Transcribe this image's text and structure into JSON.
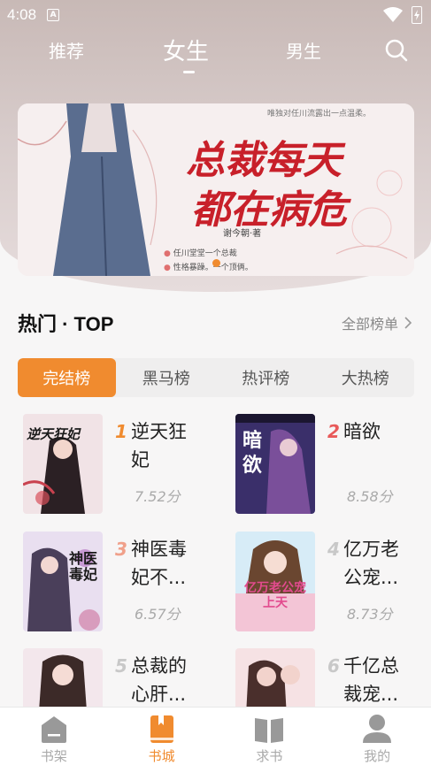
{
  "status_bar": {
    "time": "4:08",
    "notification_glyph": "A"
  },
  "top_nav": {
    "tabs": [
      {
        "label": "推荐",
        "active": false
      },
      {
        "label": "女生",
        "active": true
      },
      {
        "label": "男生",
        "active": false
      }
    ],
    "search_icon": "search-icon"
  },
  "banner": {
    "title_line1": "总裁每天",
    "title_line2": "都在病危",
    "author": "谢今朝·著",
    "tagline": "唯独对任川流露出一点温柔。",
    "blurb_line1": "任川堂堂一个总裁",
    "blurb_line2": "性格暴躁。一个顶俩。",
    "active_dot": 0
  },
  "section": {
    "title": "热门 · TOP",
    "more": "全部榜单"
  },
  "rank_tabs": [
    {
      "label": "完结榜",
      "active": true
    },
    {
      "label": "黑马榜",
      "active": false
    },
    {
      "label": "热评榜",
      "active": false
    },
    {
      "label": "大热榜",
      "active": false
    }
  ],
  "books": [
    {
      "rank": "1",
      "title": "逆天狂妃",
      "score": "7.52分",
      "cover_text": "逆天狂妃"
    },
    {
      "rank": "2",
      "title": "暗欲",
      "score": "8.58分",
      "cover_text": "暗欲"
    },
    {
      "rank": "3",
      "title": "神医毒妃不...",
      "score": "6.57分",
      "cover_text": "神医毒妃"
    },
    {
      "rank": "4",
      "title": "亿万老公宠...",
      "score": "8.73分",
      "cover_text": "亿万老公宠上天"
    },
    {
      "rank": "5",
      "title": "总裁的心肝...",
      "score": "",
      "cover_text": ""
    },
    {
      "rank": "6",
      "title": "千亿总裁宠...",
      "score": "",
      "cover_text": ""
    }
  ],
  "colors": {
    "accent": "#f08b2f",
    "rank1": "#f08b2f",
    "rank2": "#e85a5a",
    "rank3": "#f0a08a",
    "rank_other": "#c8c8c8"
  },
  "bottom_nav": [
    {
      "label": "书架",
      "icon": "bookshelf-icon",
      "active": false
    },
    {
      "label": "书城",
      "icon": "bookstore-icon",
      "active": true
    },
    {
      "label": "求书",
      "icon": "open-book-icon",
      "active": false
    },
    {
      "label": "我的",
      "icon": "user-icon",
      "active": false
    }
  ]
}
